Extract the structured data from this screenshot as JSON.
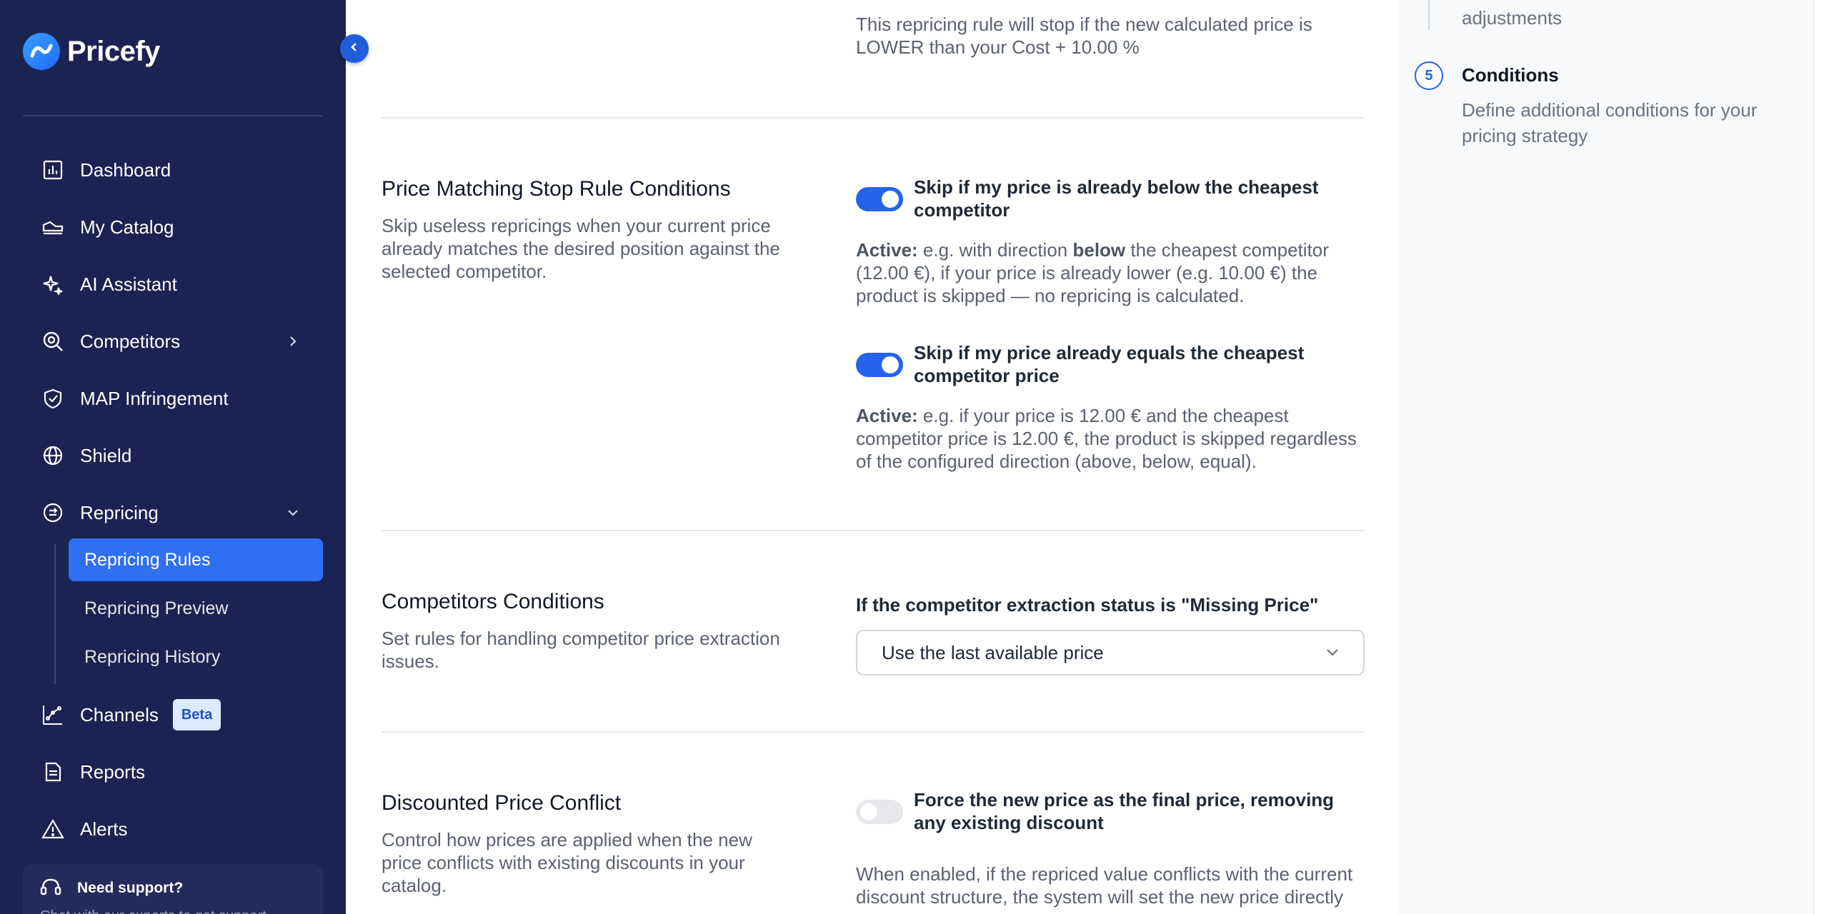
{
  "app": {
    "name": "Pricefy"
  },
  "sidebar": {
    "items": [
      {
        "label": "Dashboard",
        "icon": "chart-bar-icon"
      },
      {
        "label": "My Catalog",
        "icon": "catalog-icon"
      },
      {
        "label": "AI Assistant",
        "icon": "sparkle-icon"
      },
      {
        "label": "Competitors",
        "icon": "search-competitor-icon"
      },
      {
        "label": "MAP Infringement",
        "icon": "shield-check-icon"
      },
      {
        "label": "Shield",
        "icon": "globe-icon"
      },
      {
        "label": "Repricing",
        "icon": "repricing-icon"
      },
      {
        "label": "Channels",
        "icon": "channels-icon",
        "badge": "Beta"
      },
      {
        "label": "Reports",
        "icon": "document-icon"
      },
      {
        "label": "Alerts",
        "icon": "warning-icon"
      }
    ],
    "repricing_sub": [
      {
        "label": "Repricing Rules",
        "active": true
      },
      {
        "label": "Repricing Preview"
      },
      {
        "label": "Repricing History"
      }
    ],
    "support": {
      "title": "Need support?",
      "subtitle": "Chat with our experts to get support."
    }
  },
  "main": {
    "top_text_line1": "This repricing rule will stop if the new calculated price is",
    "top_text_line2": "LOWER than your Cost + 10.00 %",
    "price_matching": {
      "title": "Price Matching Stop Rule Conditions",
      "description": "Skip useless repricings when your current price already matches the desired position against the selected competitor.",
      "toggle1": {
        "label": "Skip if my price is already below the cheapest competitor",
        "state": "on",
        "active_prefix": "Active:",
        "desc_part1": " e.g. with direction ",
        "desc_bold": "below",
        "desc_part2": " the cheapest competitor (12.00 €), if your price is already lower (e.g. 10.00 €) the product is skipped — no repricing is calculated."
      },
      "toggle2": {
        "label": "Skip if my price already equals the cheapest competitor price",
        "state": "on",
        "active_prefix": "Active:",
        "desc": " e.g. if your price is 12.00 € and the cheapest competitor price is 12.00 €, the product is skipped regardless of the configured direction (above, below, equal)."
      }
    },
    "competitors": {
      "title": "Competitors Conditions",
      "description": "Set rules for handling competitor price extraction issues.",
      "field_label": "If the competitor extraction status is \"Missing Price\"",
      "select_value": "Use the last available price"
    },
    "discounted": {
      "title": "Discounted Price Conflict",
      "description": "Control how prices are applied when the new price conflicts with existing discounts in your catalog.",
      "toggle_label": "Force the new price as the final price, removing any existing discount",
      "toggle_state": "off",
      "toggle_desc": "When enabled, if the repriced value conflicts with the current discount structure, the system will set the new price directly"
    }
  },
  "stepper": {
    "prev_text": "adjustments",
    "step_number": "5",
    "step_title": "Conditions",
    "step_desc": "Define additional conditions for your pricing strategy"
  },
  "colors": {
    "sidebar_bg": "#1b2352",
    "accent": "#2563eb",
    "active_item": "#2f6ff2"
  }
}
